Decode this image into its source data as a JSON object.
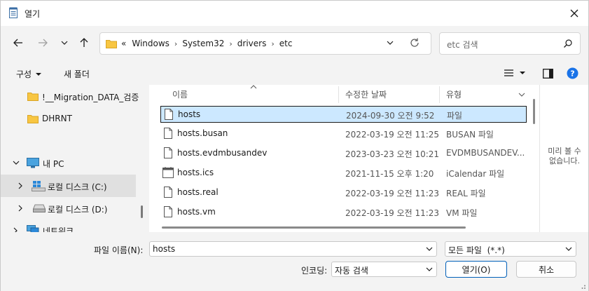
{
  "window": {
    "title": "열기"
  },
  "address": {
    "crumbs": [
      "Windows",
      "System32",
      "drivers",
      "etc"
    ],
    "overflow": "«"
  },
  "search": {
    "placeholder": "etc 검색"
  },
  "toolbar": {
    "organize": "구성",
    "new_folder": "새 폴더"
  },
  "sidebar": {
    "items": [
      {
        "label": "!__Migration_DATA_검증"
      },
      {
        "label": "DHRNT"
      },
      {
        "label": "내 PC"
      },
      {
        "label": "로컬 디스크 (C:)"
      },
      {
        "label": "로컬 디스크 (D:)"
      },
      {
        "label": "네트워크"
      }
    ]
  },
  "columns": {
    "name": "이름",
    "date": "수정한 날짜",
    "type": "유형"
  },
  "files": [
    {
      "name": "hosts",
      "date": "2024-09-30 오전 9:52",
      "type": "파일",
      "icon": "file-icon"
    },
    {
      "name": "hosts.busan",
      "date": "2022-03-19 오전 11:25",
      "type": "BUSAN 파일",
      "icon": "file-icon"
    },
    {
      "name": "hosts.evdmbusandev",
      "date": "2023-03-23 오전 10:21",
      "type": "EVDMBUSANDEV...",
      "icon": "file-icon"
    },
    {
      "name": "hosts.ics",
      "date": "2021-11-15 오후 1:20",
      "type": "iCalendar 파일",
      "icon": "calendar-file-icon"
    },
    {
      "name": "hosts.real",
      "date": "2022-03-19 오전 11:23",
      "type": "REAL 파일",
      "icon": "file-icon"
    },
    {
      "name": "hosts.vm",
      "date": "2022-03-19 오전 11:23",
      "type": "VM 파일",
      "icon": "file-icon"
    }
  ],
  "preview": {
    "text_line1": "미리 볼 수",
    "text_line2": "없습니다."
  },
  "bottom": {
    "filename_label": "파일 이름(N):",
    "filename_value": "hosts",
    "filetype_value": "모든 파일  (*.*)",
    "encoding_label": "인코딩:",
    "encoding_value": "자동 검색",
    "open_label": "열기(O)",
    "cancel_label": "취소"
  },
  "colors": {
    "accent": "#005fb8",
    "selection": "#cce8ff",
    "folder": "#f8c642"
  }
}
